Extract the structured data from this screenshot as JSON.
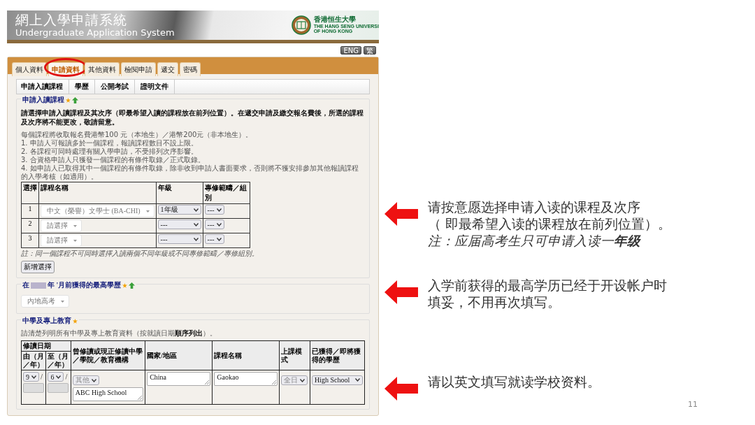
{
  "header": {
    "title_zh": "網上入學申請系統",
    "title_en": "Undergraduate Application System",
    "university_zh": "香港恒生大學",
    "university_en_1": "THE HANG SENG UNIVERSI",
    "university_en_2": "OF HONG KONG"
  },
  "language_buttons": [
    "ENG",
    "繁"
  ],
  "tabs": [
    {
      "label": "個人資料",
      "selected": false,
      "circled": false
    },
    {
      "label": "申請資料",
      "selected": true,
      "circled": true
    },
    {
      "label": "其他資料",
      "selected": false,
      "circled": false
    },
    {
      "label": "檢閱申請",
      "selected": false,
      "circled": false
    },
    {
      "label": "遞交",
      "selected": false,
      "circled": false
    },
    {
      "label": "密碼",
      "selected": false,
      "circled": false
    }
  ],
  "subtabs": [
    "申請入讀課程",
    "學歷",
    "公開考試",
    "證明文件"
  ],
  "course_section": {
    "title": "申請入讀課程",
    "intro": "請選擇申請入讀課程及其次序（即最希望入讀的課程放在前列位置）。在遞交申請及繳交報名費後，所選的課程及次序將不能更改，敬請留意。",
    "notes": [
      "每個課程將收取報名費港幣100 元（本地生）／港幣200元（非本地生）。",
      "1. 申請人可報讀多於一個課程，報讀課程數目不設上限。",
      "2. 各課程可同時處理有關入學申請，不受排列次序影響。",
      "3. 合資格申請人只獲發一個課程的有條件取錄／正式取錄。",
      "4. 如申請人已取得其中一個課程的有條件取錄，除非收到申請人書面要求，否則將不獲安排參加其他報讀課程的入學考核（如適用）。"
    ],
    "columns": [
      "選擇",
      "課程名稱",
      "年級",
      "專修範疇／組別"
    ],
    "rows": [
      {
        "number": "1",
        "programme": "中文（榮譽）文學士 (BA-CHI)",
        "year": "1年級",
        "stream": "---"
      },
      {
        "number": "2",
        "programme": "請選擇",
        "year": "---",
        "stream": "---"
      },
      {
        "number": "3",
        "programme": "請選擇",
        "year": "---",
        "stream": "---"
      }
    ],
    "footnote": "註：同一個課程不可同時選擇入讀兩個不同年級或不同專修範疇／專修組別。",
    "add_button": "新增選擇"
  },
  "qualification_section": {
    "title_before": "在",
    "title_after": "年 '月前獲得的最高學歷",
    "value": "內地高考"
  },
  "education_section": {
    "title": "中學及專上教育",
    "intro": "請清楚列明所有中學及專上教育資料（按就讀日期**順序列出**）。",
    "date_group": "修讀日期",
    "columns": [
      "由（月／年）",
      "至（月／年）",
      "曾修讀或現正修讀中學／學院／教育機構",
      "國家/地區",
      "課程名稱",
      "上課模式",
      "已獲得／即將獲得的學歷"
    ],
    "rows": [
      {
        "from_month": {
          "value": "9",
          "disabled": false
        },
        "from_separator": "/",
        "to_month": {
          "value": "6",
          "disabled": false
        },
        "to_separator": "/",
        "institution_type": {
          "value": "其他",
          "disabled": true
        },
        "institution": "ABC High School",
        "country": "China",
        "programme": "Gaokao",
        "mode": {
          "value": "全日",
          "disabled": true
        },
        "qualification": {
          "value": "High School",
          "disabled": false
        }
      }
    ]
  },
  "slide": {
    "annotations": [
      {
        "lines": [
          {
            "text": "请按意愿选择申请入读的课程及次序",
            "italic": false
          },
          {
            "text": "（ 即最希望入读的课程放在前列位置）。",
            "italic": false
          },
          {
            "text": "注：应届高考生只可申请入读一**年级**",
            "italic": true
          }
        ]
      },
      {
        "lines": [
          {
            "text": "入学前获得的最高学历已经于开设帐户时",
            "italic": false
          },
          {
            "text": "填妥，不用再次填写。",
            "italic": false
          }
        ]
      },
      {
        "lines": [
          {
            "text": "请以英文填写就读学校资料。",
            "italic": false
          }
        ]
      }
    ],
    "page_number": "11"
  }
}
